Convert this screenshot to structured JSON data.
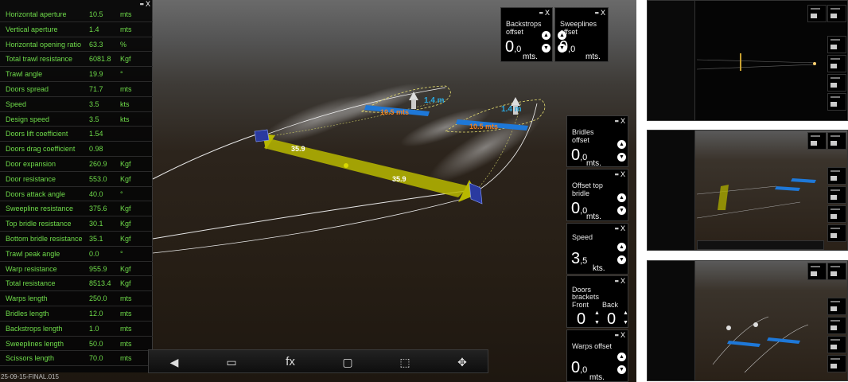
{
  "params_panel": {
    "rows": [
      {
        "label": "Horizontal aperture",
        "value": "10.5",
        "unit": "mts"
      },
      {
        "label": "Vertical aperture",
        "value": "1.4",
        "unit": "mts"
      },
      {
        "label": "Horizontal opening ratio",
        "value": "63.3",
        "unit": "%"
      },
      {
        "label": "Total trawl resistance",
        "value": "6081.8",
        "unit": "Kgf"
      },
      {
        "label": "Trawl angle",
        "value": "19.9",
        "unit": "°"
      },
      {
        "label": "Doors spread",
        "value": "71.7",
        "unit": "mts"
      },
      {
        "label": "Speed",
        "value": "3.5",
        "unit": "kts"
      },
      {
        "label": "Design speed",
        "value": "3.5",
        "unit": "kts"
      },
      {
        "label": "Doors lift coefficient",
        "value": "1.54",
        "unit": ""
      },
      {
        "label": "Doors drag coefficient",
        "value": "0.98",
        "unit": ""
      },
      {
        "label": "Door expansion",
        "value": "260.9",
        "unit": "Kgf"
      },
      {
        "label": "Door resistance",
        "value": "553.0",
        "unit": "Kgf"
      },
      {
        "label": "Doors attack angle",
        "value": "40.0",
        "unit": "°"
      },
      {
        "label": "Sweepline resistance",
        "value": "375.6",
        "unit": "Kgf"
      },
      {
        "label": "Top bridle resistance",
        "value": "30.1",
        "unit": "Kgf"
      },
      {
        "label": "Bottom bridle resistance",
        "value": "35.1",
        "unit": "Kgf"
      },
      {
        "label": "Trawl peak angle",
        "value": "0.0",
        "unit": "°"
      },
      {
        "label": "Warp resistance",
        "value": "955.9",
        "unit": "Kgf"
      },
      {
        "label": "Total resistance",
        "value": "8513.4",
        "unit": "Kgf"
      },
      {
        "label": "Warps length",
        "value": "250.0",
        "unit": "mts"
      },
      {
        "label": "Bridles length",
        "value": "12.0",
        "unit": "mts"
      },
      {
        "label": "Backstrops length",
        "value": "1.0",
        "unit": "mts"
      },
      {
        "label": "Sweeplines length",
        "value": "50.0",
        "unit": "mts"
      },
      {
        "label": "Scissors length",
        "value": "70.0",
        "unit": "mts"
      }
    ],
    "close": "X",
    "build_label": "25-09-15-FINAL.015"
  },
  "scene_labels": {
    "spread_1": "35.9",
    "spread_2": "35.9",
    "width_1": "10.5 mts",
    "width_2": "10.5 mts",
    "height_1": "1.4 m",
    "height_2": "1.4 m"
  },
  "widgets": {
    "close": "X",
    "backstrops": {
      "title1": "Backstrops",
      "title2": "offset",
      "int": "0",
      "dec": ",0",
      "unit": "mts."
    },
    "sweeplines": {
      "title1": "Sweeplines",
      "title2": "offset",
      "int": "0",
      "dec": ",0",
      "unit": "mts."
    },
    "bridles": {
      "title1": "Bridles",
      "title2": "offset",
      "int": "0",
      "dec": ",0",
      "unit": "mts."
    },
    "top_bridle": {
      "title1": "Offset top",
      "title2": "bridle",
      "int": "0",
      "dec": ",0",
      "unit": "mts."
    },
    "speed": {
      "title1": "Speed",
      "int": "3",
      "dec": ",5",
      "unit": "kts."
    },
    "doors": {
      "title1": "Doors",
      "title2": "brackets",
      "front": "Front",
      "back": "Back",
      "front_val": "0",
      "back_val": "0"
    },
    "warps": {
      "title1": "Warps offset",
      "int": "0",
      "dec": ",0",
      "unit": "mts."
    }
  },
  "toolbar": {
    "fx_label": "fx"
  },
  "icons": {
    "up": "▲",
    "down": "▼",
    "grip": "▪▪",
    "back": "◀",
    "monitor": "▭",
    "page": "▢",
    "screenshot": "⬚",
    "fullscreen": "✥"
  },
  "colors": {
    "param_text": "#6fdc4a",
    "spread_arrow": "#c8c800",
    "width_arrow": "#1e78d8",
    "width_text": "#f08020",
    "height_text": "#2aa8e0"
  }
}
